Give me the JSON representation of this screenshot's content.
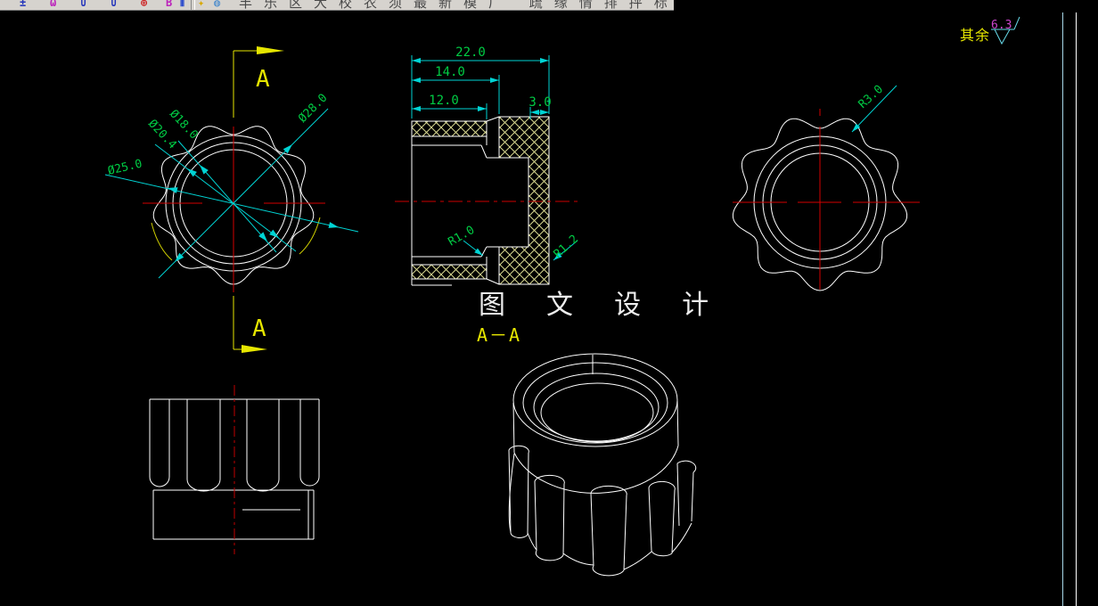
{
  "toolbar": {
    "icons": [
      {
        "name": "dim-style-icon",
        "glyph": "±",
        "color": "#2233bb"
      },
      {
        "name": "spline-icon",
        "glyph": "ω",
        "color": "#bb22bb"
      },
      {
        "name": "ucs-icon",
        "glyph": "∪",
        "color": "#2233bb"
      },
      {
        "name": "ucs-world-icon",
        "glyph": "∪",
        "color": "#2233bb"
      },
      {
        "name": "osnap-target-icon",
        "glyph": "⊕",
        "color": "#cc2222"
      },
      {
        "name": "text-style-icon",
        "glyph": "B",
        "color": "#bb22bb"
      },
      {
        "name": "columns-icon",
        "glyph": "⫴",
        "color": "#2244cc"
      },
      {
        "name": "star-icon",
        "glyph": "✦",
        "color": "#d8a800"
      },
      {
        "name": "globe-icon",
        "glyph": "◍",
        "color": "#4488cc"
      }
    ],
    "title_text": "丰乐区大校农须最新模厂 疏缘情排抨标秘子"
  },
  "front_view": {
    "dia1": "Ø18.0",
    "dia2": "Ø20.4",
    "dia3": "Ø25.0",
    "dia4": "Ø28.0",
    "cut_top": "A",
    "cut_bottom": "A"
  },
  "section_view": {
    "len_total": "22.0",
    "len_inner": "14.0",
    "len_bore": "12.0",
    "wall": "3.0",
    "fillet_inner": "R1.0",
    "fillet_outer": "R1.2",
    "label": "A－A"
  },
  "right_view": {
    "lobe_radius": "R3.0"
  },
  "notes": {
    "watermark": "图 文 设 计",
    "roughness_prefix": "其余",
    "roughness_value": "6.3"
  },
  "colors": {
    "outline": "#ffffff",
    "dim_line": "#00d4d4",
    "dim_text": "#00cc44",
    "centerline": "#d40000",
    "section_marker": "#e6e600",
    "hatch": "#d8d890",
    "roughness_value_color": "#cc44cc",
    "border_blue": "#a8d8e8"
  }
}
